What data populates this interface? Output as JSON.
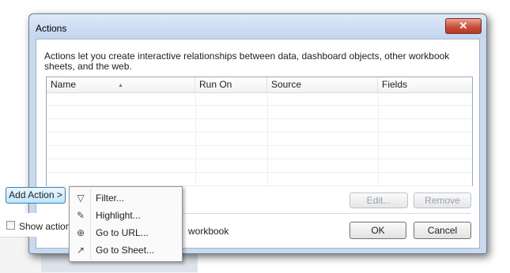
{
  "dialog": {
    "title": "Actions",
    "close_glyph": "✕",
    "description": "Actions let you create interactive relationships between data, dashboard objects, other workbook sheets, and the web.",
    "table": {
      "columns": [
        "Name",
        "Run On",
        "Source",
        "Fields"
      ],
      "sort_indicator": "▲",
      "rows": []
    },
    "buttons": {
      "edit": "Edit...",
      "remove": "Remove",
      "ok": "OK",
      "cancel": "Cancel"
    },
    "show_actions_label": "Show actions",
    "workbook_label": "workbook"
  },
  "add_action": {
    "label": "Add Action >",
    "menu": [
      {
        "label": "Filter...",
        "icon": "filter-icon",
        "glyph": "▽"
      },
      {
        "label": "Highlight...",
        "icon": "highlight-icon",
        "glyph": "✎"
      },
      {
        "label": "Go to URL...",
        "icon": "globe-icon",
        "glyph": "⊕"
      },
      {
        "label": "Go to Sheet...",
        "icon": "external-link-icon",
        "glyph": "↗"
      }
    ]
  },
  "colors": {
    "window_frame": "#c9d9ee",
    "close_button": "#c8503b",
    "add_action_highlight": "#bee6fd"
  }
}
